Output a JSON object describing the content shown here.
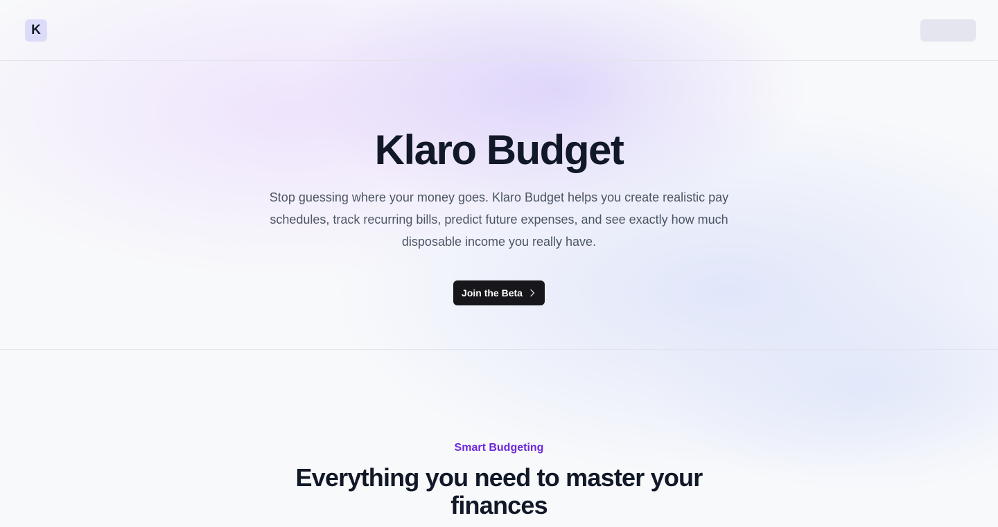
{
  "header": {
    "logo_letter": "K"
  },
  "hero": {
    "title": "Klaro Budget",
    "subtitle": "Stop guessing where your money goes. Klaro Budget helps you create realistic pay schedules, track recurring bills, predict future expenses, and see exactly how much disposable income you really have.",
    "cta_label": "Join the Beta",
    "cta_icon": "chevron-right-icon"
  },
  "features": {
    "eyebrow": "Smart Budgeting",
    "title": "Everything you need to master your finances"
  },
  "colors": {
    "text_primary": "#111827",
    "text_secondary": "#4b5563",
    "accent": "#6d28d9",
    "cta_background": "#17171b",
    "logo_background": "#dcdcfa"
  }
}
